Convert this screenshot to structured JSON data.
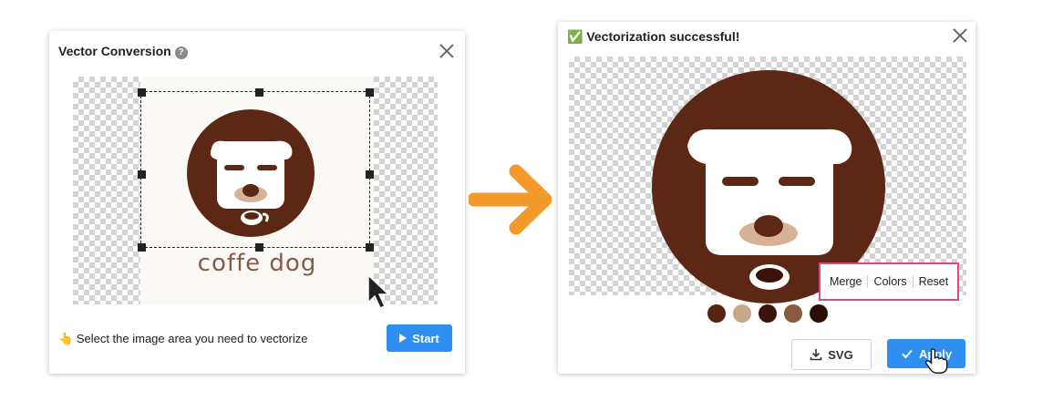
{
  "left_dialog": {
    "title": "Vector Conversion",
    "help_symbol": "?",
    "hint_emoji": "👆",
    "hint": "Select the image area you need to vectorize",
    "start_label": "Start",
    "image_caption": "coffe dog"
  },
  "right_dialog": {
    "success_emoji": "✅",
    "title": "Vectorization successful!",
    "tools": [
      "Merge",
      "Colors",
      "Reset"
    ],
    "palette": [
      "#5a2413",
      "#c8a688",
      "#3a140a",
      "#8a5a40",
      "#2a0d06"
    ],
    "svg_label": "SVG",
    "apply_label": "Apply"
  },
  "colors": {
    "brown": "#5d2716",
    "accent_blue": "#2f8ff0",
    "highlight": "#e8457d",
    "arrow": "#f39a2b"
  }
}
